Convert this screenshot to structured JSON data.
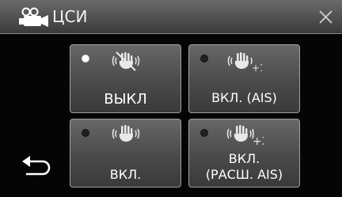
{
  "header": {
    "title": "ЦСИ",
    "mode_icon": "video-camera-icon",
    "close_icon": "close-icon"
  },
  "back": {
    "icon": "back-arrow-icon"
  },
  "options": [
    {
      "label": "ВЫКЛ",
      "icon": "stabilizer-off-icon",
      "selected": true
    },
    {
      "label": "ВКЛ. (AIS)",
      "icon": "stabilizer-ais-icon",
      "selected": false,
      "icon_suffix": "+1"
    },
    {
      "label": "ВКЛ.",
      "icon": "stabilizer-on-icon",
      "selected": false
    },
    {
      "label_line1": "ВКЛ.",
      "label_line2": "(РАСШ. AIS)",
      "icon": "stabilizer-extended-ais-icon",
      "selected": false,
      "icon_suffix": "+2"
    }
  ],
  "colors": {
    "selected_indicator": "#ffffff",
    "unselected_indicator": "#202020",
    "button_border": "#a0a0a0"
  }
}
